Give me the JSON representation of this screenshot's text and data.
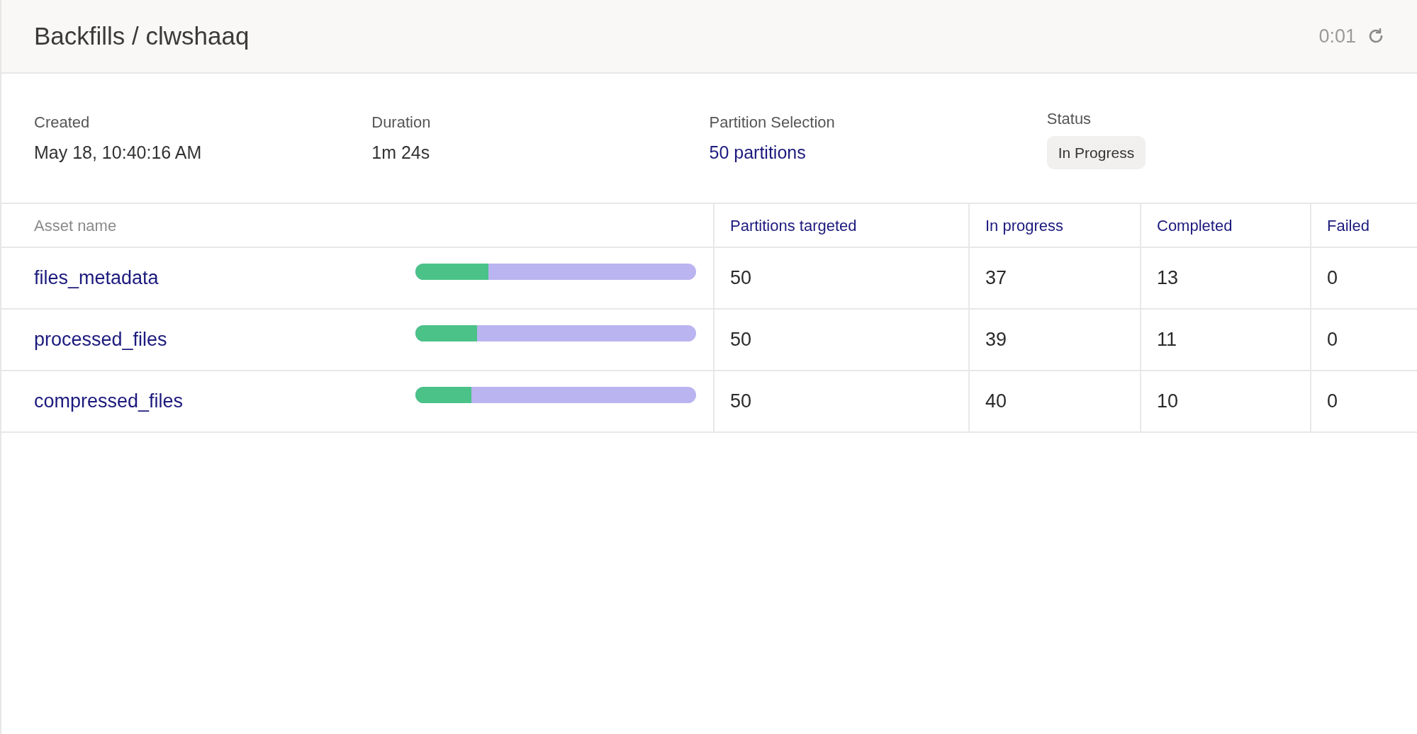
{
  "header": {
    "title": "Backfills / clwshaaq",
    "timer": "0:01"
  },
  "stats": [
    {
      "kind": "text",
      "label": "Created",
      "value": "May 18, 10:40:16 AM"
    },
    {
      "kind": "text",
      "label": "Duration",
      "value": "1m 24s"
    },
    {
      "kind": "link",
      "label": "Partition Selection",
      "value": "50 partitions"
    },
    {
      "kind": "tag",
      "label": "Status",
      "value": "In Progress"
    }
  ],
  "table": {
    "columns": [
      "Asset name",
      "Partitions targeted",
      "In progress",
      "Completed",
      "Failed"
    ],
    "rows": [
      {
        "name": "files_metadata",
        "level": 0.26,
        "targeted": "50",
        "in_progress": "37",
        "completed": "13",
        "failed": "0"
      },
      {
        "name": "processed_files",
        "level": 0.22,
        "targeted": "50",
        "in_progress": "39",
        "completed": "11",
        "failed": "0"
      },
      {
        "name": "compressed_files",
        "level": 0.2,
        "targeted": "50",
        "in_progress": "40",
        "completed": "10",
        "failed": "0"
      }
    ]
  }
}
